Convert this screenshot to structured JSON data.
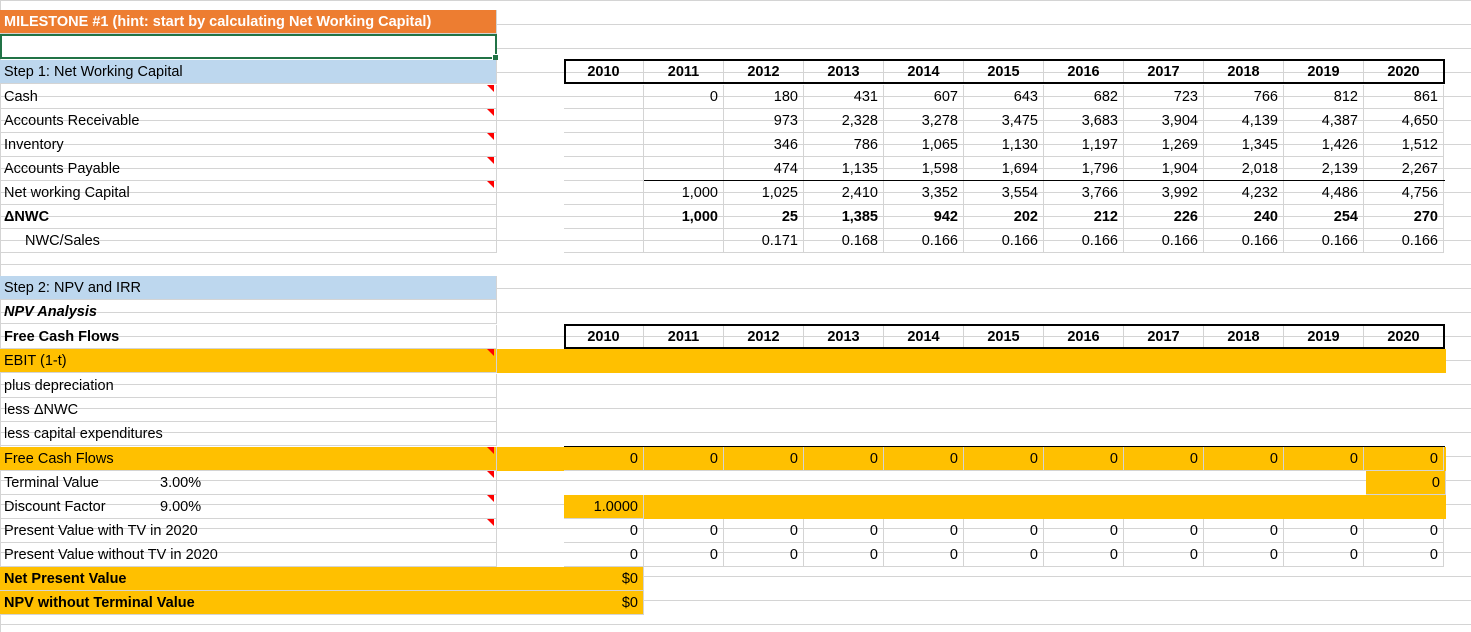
{
  "milestone_title": "MILESTONE #1 (hint: start by calculating Net Working Capital)",
  "years": [
    "2010",
    "2011",
    "2012",
    "2013",
    "2014",
    "2015",
    "2016",
    "2017",
    "2018",
    "2019",
    "2020"
  ],
  "step1": {
    "title": "Step 1: Net Working Capital",
    "rows": [
      {
        "label": "Cash",
        "values": [
          "",
          "0",
          "180",
          "431",
          "607",
          "643",
          "682",
          "723",
          "766",
          "812",
          "861"
        ]
      },
      {
        "label": "Accounts Receivable",
        "values": [
          "",
          "",
          "973",
          "2,328",
          "3,278",
          "3,475",
          "3,683",
          "3,904",
          "4,139",
          "4,387",
          "4,650"
        ]
      },
      {
        "label": "Inventory",
        "values": [
          "",
          "",
          "346",
          "786",
          "1,065",
          "1,130",
          "1,197",
          "1,269",
          "1,345",
          "1,426",
          "1,512"
        ]
      },
      {
        "label": "Accounts Payable",
        "values": [
          "",
          "",
          "474",
          "1,135",
          "1,598",
          "1,694",
          "1,796",
          "1,904",
          "2,018",
          "2,139",
          "2,267"
        ]
      },
      {
        "label": "Net working Capital",
        "values": [
          "",
          "1,000",
          "1,025",
          "2,410",
          "3,352",
          "3,554",
          "3,766",
          "3,992",
          "4,232",
          "4,486",
          "4,756"
        ]
      },
      {
        "label": "ΔNWC",
        "values": [
          "",
          "1,000",
          "25",
          "1,385",
          "942",
          "202",
          "212",
          "226",
          "240",
          "254",
          "270"
        ]
      },
      {
        "label": "NWC/Sales",
        "values": [
          "",
          "",
          "0.171",
          "0.168",
          "0.166",
          "0.166",
          "0.166",
          "0.166",
          "0.166",
          "0.166",
          "0.166"
        ]
      }
    ]
  },
  "step2": {
    "title": "Step 2: NPV and IRR",
    "npv_analysis": "NPV Analysis",
    "fcf_header": "Free Cash Flows",
    "ebit": "EBIT (1-t)",
    "plus_dep": "plus depreciation",
    "less_nwc": "less ΔNWC",
    "less_capex": "less capital expenditures",
    "fcf_row": {
      "label": "Free Cash Flows",
      "values": [
        "0",
        "0",
        "0",
        "0",
        "0",
        "0",
        "0",
        "0",
        "0",
        "0",
        "0"
      ]
    },
    "terminal_value": {
      "label": "Terminal Value",
      "rate": "3.00%",
      "value_2020": "0"
    },
    "discount_factor": {
      "label": "Discount Factor",
      "rate": "9.00%",
      "value_2010": "1.0000"
    },
    "pv_with_tv": {
      "label": "Present Value with TV in 2020",
      "values": [
        "0",
        "0",
        "0",
        "0",
        "0",
        "0",
        "0",
        "0",
        "0",
        "0",
        "0"
      ]
    },
    "pv_without_tv": {
      "label": "Present Value without TV in 2020",
      "values": [
        "0",
        "0",
        "0",
        "0",
        "0",
        "0",
        "0",
        "0",
        "0",
        "0",
        "0"
      ]
    },
    "npv": {
      "label": "Net Present Value",
      "value": "$0"
    },
    "npv_no_tv": {
      "label": "NPV without Terminal Value",
      "value": "$0"
    }
  },
  "colors": {
    "orange": "#ed7d31",
    "lightblue": "#bdd7ee",
    "gold": "#ffc000",
    "select": "#217346"
  }
}
